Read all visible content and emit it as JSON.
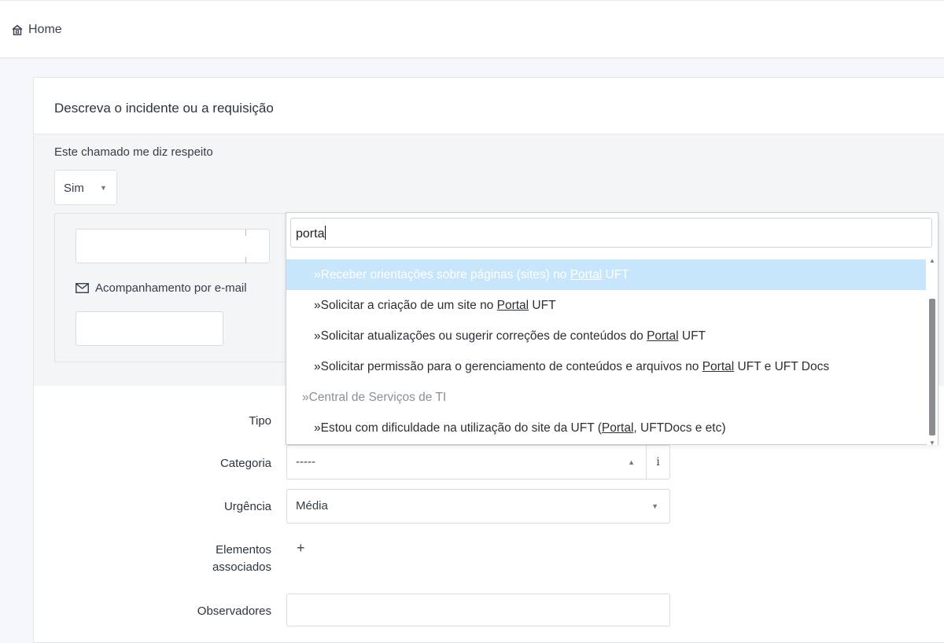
{
  "breadcrumb": {
    "home_label": "Home"
  },
  "form": {
    "title": "Descreva o incidente ou a requisição",
    "self_label": "Este chamado me diz respeito",
    "self_value": "Sim",
    "email_label": "Acompanhamento por e-mail",
    "fields": {
      "tipo_label": "Tipo",
      "categoria_label": "Categoria",
      "categoria_value": "-----",
      "info_label": "i",
      "urgencia_label": "Urgência",
      "urgencia_value": "Média",
      "elementos_label_line1": "Elementos",
      "elementos_label_line2": "associados",
      "add_label": "+",
      "observadores_label": "Observadores"
    }
  },
  "dropdown": {
    "search_value": "porta",
    "items": [
      {
        "prefix": "»Receber orientações sobre páginas (sites) no ",
        "match": "Portal",
        "suffix": " UFT",
        "highlighted": true
      },
      {
        "prefix": "»Solicitar a criação de um site no ",
        "match": "Portal",
        "suffix": " UFT"
      },
      {
        "prefix": "»Solicitar atualizações ou sugerir correções de conteúdos do ",
        "match": "Portal",
        "suffix": " UFT"
      },
      {
        "prefix": "»Solicitar permissão para o gerenciamento de conteúdos e arquivos no ",
        "match": "Portal",
        "suffix": " UFT e UFT Docs"
      },
      {
        "group": "»Central de Serviços de TI"
      },
      {
        "prefix": "»Estou com dificuldade na utilização do site da UFT (",
        "match": "Portal",
        "suffix": ", UFTDocs e etc)"
      }
    ]
  },
  "colors": {
    "highlight_bg": "#c7e6fb",
    "section_bg": "#f4f5f7"
  }
}
